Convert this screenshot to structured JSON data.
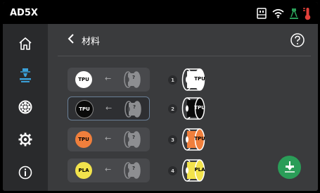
{
  "topbar": {
    "model": "AD5X",
    "icons": [
      "usb-icon",
      "wifi-icon",
      "printer-status-icon",
      "thermometer-icon"
    ]
  },
  "sidebar": {
    "items": [
      {
        "name": "home",
        "icon": "home-icon",
        "active": false
      },
      {
        "name": "print",
        "icon": "nozzle-icon",
        "active": true
      },
      {
        "name": "filament",
        "icon": "spool-icon",
        "active": false
      },
      {
        "name": "settings",
        "icon": "gear-icon",
        "active": false
      },
      {
        "name": "info",
        "icon": "info-icon",
        "active": false
      }
    ]
  },
  "header": {
    "title": "材料",
    "back_icon": "chevron-left-icon",
    "help_icon": "help-icon"
  },
  "materials": [
    {
      "type": "TPU",
      "color": "#ffffff",
      "text_color": "#000000",
      "selected": false,
      "unknown_mark": "?"
    },
    {
      "type": "TPU",
      "color": "#0a0a0a",
      "text_color": "#ffffff",
      "selected": true,
      "unknown_mark": "?"
    },
    {
      "type": "TPU",
      "color": "#f07f3c",
      "text_color": "#000000",
      "selected": false,
      "unknown_mark": "?"
    },
    {
      "type": "PLA",
      "color": "#f2e34c",
      "text_color": "#000000",
      "selected": false,
      "unknown_mark": "?"
    }
  ],
  "slots": [
    {
      "number": "1",
      "type": "TPU",
      "color": "#ffffff",
      "text_color": "#000000"
    },
    {
      "number": "2",
      "type": "TPU",
      "color": "#0a0a0a",
      "text_color": "#ffffff"
    },
    {
      "number": "3",
      "type": "TPU",
      "color": "#f07f3c",
      "text_color": "#000000"
    },
    {
      "number": "4",
      "type": "PLA",
      "color": "#f2e34c",
      "text_color": "#000000"
    }
  ],
  "arrow_glyph": "←",
  "action": {
    "icon": "load-filament-icon",
    "color": "#2a9d58"
  },
  "colors": {
    "accent": "#2a9d58",
    "active_nav": "#3aa0d8",
    "alert_red": "#e2403a"
  }
}
